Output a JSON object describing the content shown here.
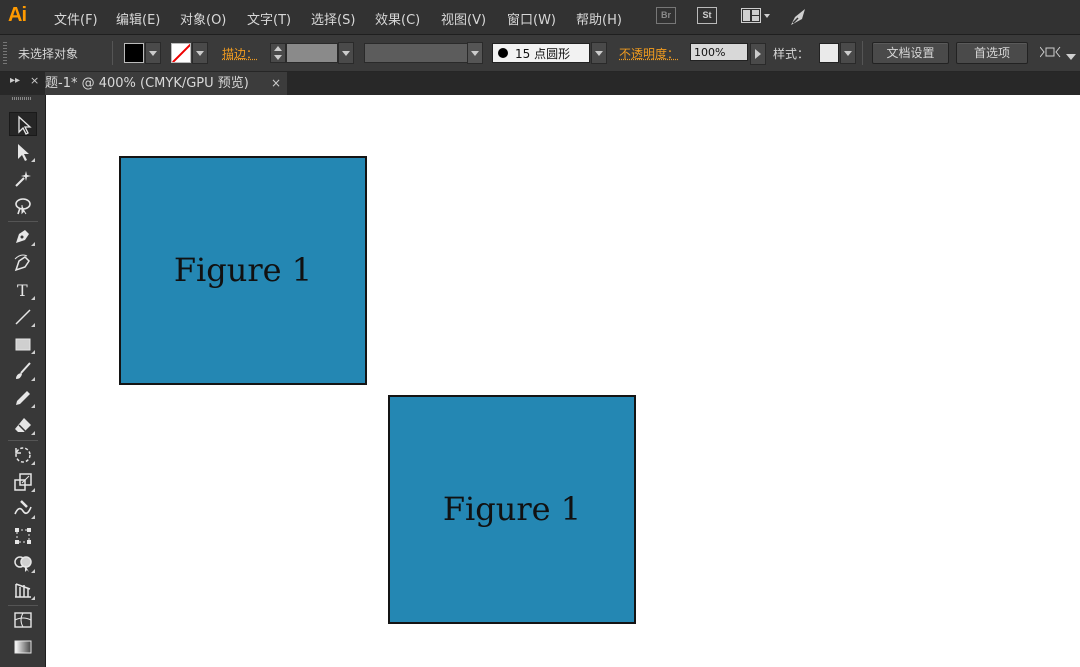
{
  "app": {
    "logo": "Ai"
  },
  "menubar": {
    "items": [
      "文件(F)",
      "编辑(E)",
      "对象(O)",
      "文字(T)",
      "选择(S)",
      "效果(C)",
      "视图(V)",
      "窗口(W)",
      "帮助(H)"
    ],
    "icons": [
      "Br",
      "St"
    ]
  },
  "controlbar": {
    "selection_status": "未选择对象",
    "stroke_label": "描边：",
    "brush": {
      "size": "15",
      "shape": "点圆形"
    },
    "opacity_label": "不透明度：",
    "opacity_value": "100%",
    "style_label": "样式：",
    "doc_setup_button": "文档设置",
    "preferences_button": "首选项"
  },
  "tabs": {
    "document": "题-1* @ 400% (CMYK/GPU 预览)",
    "close": "×"
  },
  "toolbar": {
    "tools": [
      "selection",
      "direct-selection",
      "magic-wand",
      "lasso",
      "pen",
      "curvature",
      "type",
      "line-segment",
      "rectangle",
      "paintbrush",
      "pencil",
      "eraser",
      "rotate",
      "scale",
      "warp",
      "free-transform",
      "shape-builder",
      "perspective-grid",
      "mesh",
      "gradient"
    ]
  },
  "canvas": {
    "figures": [
      {
        "label": "Figure 1"
      },
      {
        "label": "Figure 1"
      }
    ],
    "figure_color": "#2487b3"
  },
  "colors": {
    "accent": "#ff9a00",
    "link": "#f29c1f"
  }
}
